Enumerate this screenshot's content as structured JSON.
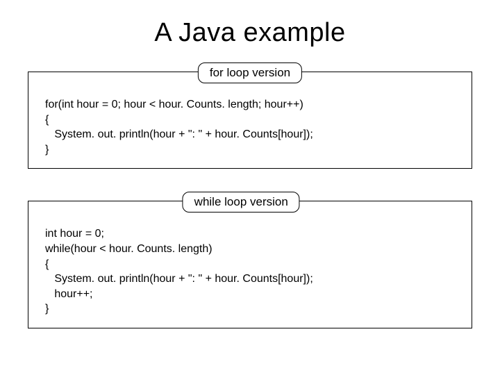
{
  "title": "A Java example",
  "blocks": [
    {
      "badge": "for loop version",
      "code": "for(int hour = 0; hour < hour. Counts. length; hour++)\n{\n   System. out. println(hour + \": \" + hour. Counts[hour]);\n}"
    },
    {
      "badge": "while loop version",
      "code": "int hour = 0;\nwhile(hour < hour. Counts. length)\n{\n   System. out. println(hour + \": \" + hour. Counts[hour]);\n   hour++;\n}"
    }
  ]
}
